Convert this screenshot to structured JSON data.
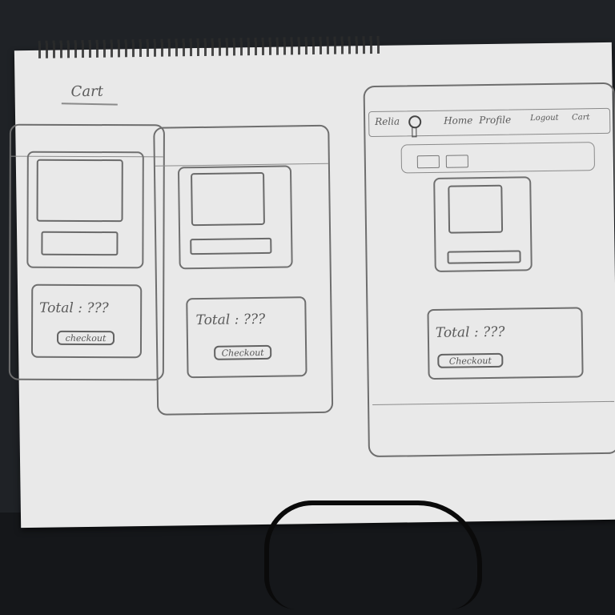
{
  "sketch": {
    "heading": "Cart",
    "mobile_1": {
      "total_label": "Total : ???",
      "checkout_label": "checkout"
    },
    "mobile_2": {
      "total_label": "Total : ???",
      "checkout_label": "Checkout"
    },
    "desktop": {
      "nav": {
        "logo": "Relia",
        "home": "Home",
        "profile": "Profile",
        "logout": "Logout",
        "cart": "Cart"
      },
      "total_label": "Total : ???",
      "checkout_label": "Checkout"
    }
  }
}
